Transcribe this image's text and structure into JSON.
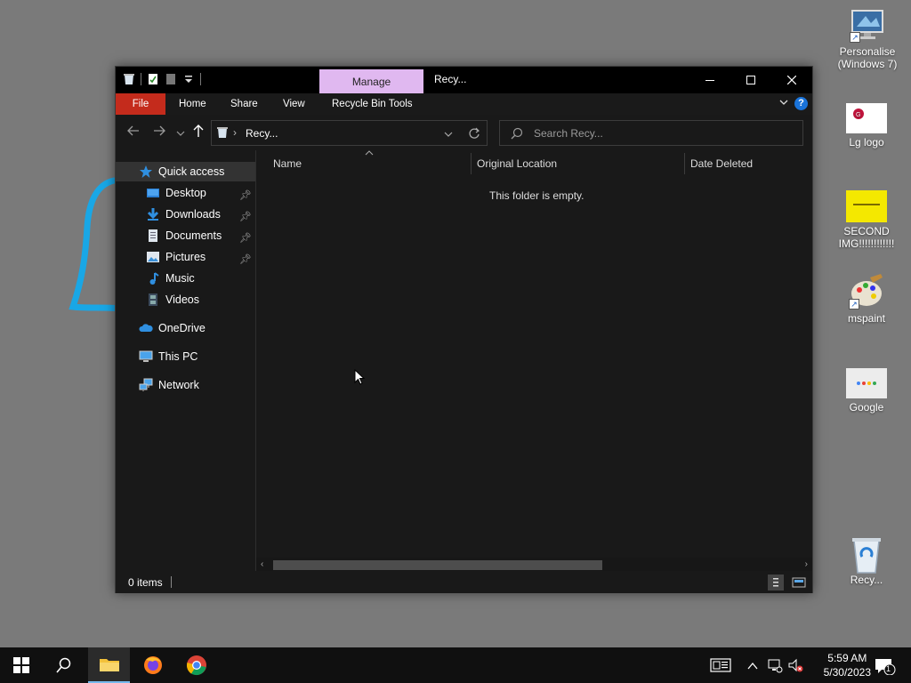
{
  "desktop": {
    "icons": [
      {
        "label": "Personalise (Windows 7)"
      },
      {
        "label": "Lg logo"
      },
      {
        "label": "SECOND IMG!!!!!!!!!!!!"
      },
      {
        "label": "mspaint"
      },
      {
        "label": "Google"
      },
      {
        "label": "Recy..."
      }
    ]
  },
  "window": {
    "title": "Recy...",
    "contextual_tab": "Manage",
    "ribbon_tabs": [
      "File",
      "Home",
      "Share",
      "View",
      "Recycle Bin Tools"
    ],
    "address": "Recy...",
    "search_placeholder": "Search Recy...",
    "nav": {
      "quick_access": "Quick access",
      "pinned": [
        "Desktop",
        "Downloads",
        "Documents",
        "Pictures"
      ],
      "unpinned": [
        "Music",
        "Videos"
      ],
      "onedrive": "OneDrive",
      "this_pc": "This PC",
      "network": "Network"
    },
    "columns": [
      "Name",
      "Original Location",
      "Date Deleted"
    ],
    "empty_message": "This folder is empty.",
    "status": "0 items"
  },
  "taskbar": {
    "time": "5:59 AM",
    "date": "5/30/2023",
    "notification_count": "1"
  },
  "colors": {
    "desktop_bg": "#7a7a7a",
    "window_bg": "#191919",
    "file_tab": "#c42b1c",
    "manage_tab": "#e0b8f0",
    "accent": "#76b9ed"
  }
}
